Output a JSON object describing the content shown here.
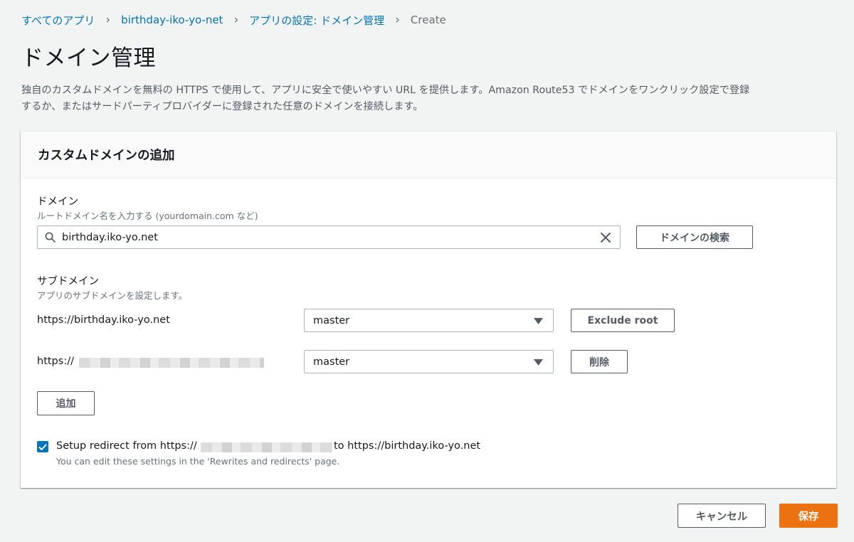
{
  "breadcrumb": {
    "items": [
      "すべてのアプリ",
      "birthday-iko-yo-net",
      "アプリの設定: ドメイン管理"
    ],
    "current": "Create",
    "separator": "›"
  },
  "page": {
    "title": "ドメイン管理",
    "description_line1": "独自のカスタムドメインを無料の HTTPS で使用して、アプリに安全で使いやすい URL を提供します。Amazon Route53 でドメインをワンクリック設定で登録",
    "description_line2": "するか、またはサードパーティプロバイダーに登録された任意のドメインを接続します。"
  },
  "panel": {
    "title": "カスタムドメインの追加",
    "domain": {
      "label": "ドメイン",
      "description": "ルートドメイン名を入力する (yourdomain.com など)",
      "value": "birthday.iko-yo.net",
      "search_button": "ドメインの検索"
    },
    "subdomain": {
      "label": "サブドメイン",
      "description": "アプリのサブドメインを設定します。",
      "rows": [
        {
          "url": "https://birthday.iko-yo.net",
          "branch": "master",
          "action": "Exclude root"
        },
        {
          "url": "https://",
          "branch": "master",
          "action": "削除"
        }
      ],
      "add_button": "追加"
    },
    "redirect": {
      "checked": true,
      "prefix": "Setup redirect from https://",
      "suffix": "to https://birthday.iko-yo.net",
      "hint": "You can edit these settings in the 'Rewrites and redirects' page."
    }
  },
  "footer": {
    "cancel": "キャンセル",
    "save": "保存"
  },
  "colors": {
    "link": "#0073bb",
    "primary": "#ec7211",
    "background": "#f2f3f3",
    "checkbox": "#0073bb"
  },
  "icons": {
    "search": "search-icon",
    "clear": "close-icon",
    "dropdown": "caret-down-icon",
    "check": "check-icon"
  }
}
